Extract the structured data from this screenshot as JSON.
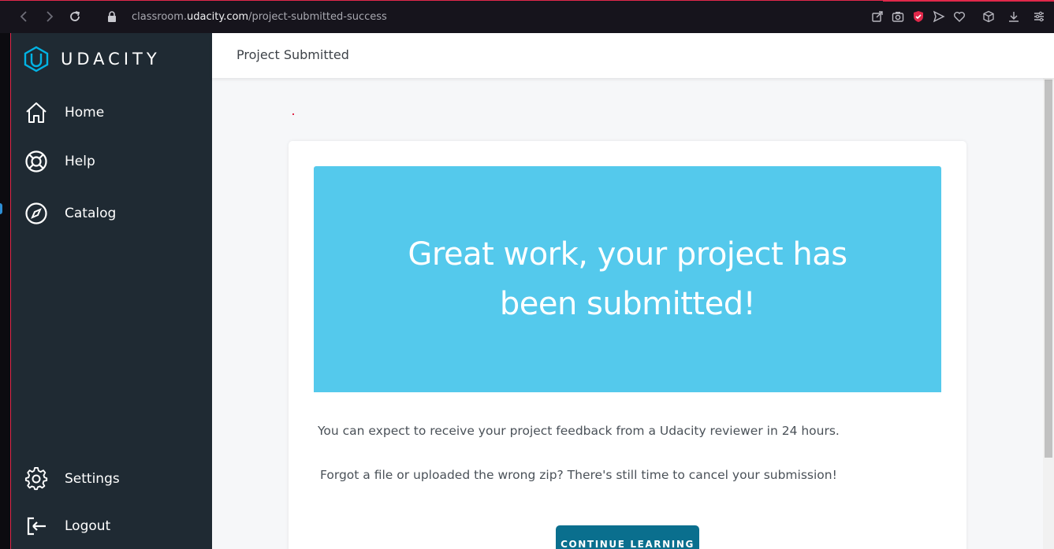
{
  "browser": {
    "url_prefix": "classroom.",
    "url_domain": "udacity.com",
    "url_path": "/project-submitted-success",
    "icons": [
      "back-icon",
      "forward-icon",
      "reload-icon",
      "lock-icon",
      "share-icon",
      "camera-icon",
      "shield-icon",
      "send-icon",
      "heart-icon",
      "cube-icon",
      "download-icon",
      "menu-icon"
    ]
  },
  "sidebar": {
    "logo_text": "UDACITY",
    "items": [
      {
        "label": "Home",
        "icon": "home-icon"
      },
      {
        "label": "Help",
        "icon": "lifebuoy-icon"
      },
      {
        "label": "Catalog",
        "icon": "compass-icon"
      },
      {
        "label": "Settings",
        "icon": "gear-icon"
      },
      {
        "label": "Logout",
        "icon": "logout-icon"
      }
    ]
  },
  "header": {
    "title": "Project Submitted"
  },
  "card": {
    "banner_text": "Great work, your project has been submitted!",
    "message_1": "You can expect to receive your project feedback from a Udacity reviewer in 24 hours.",
    "message_2": "Forgot a file or uploaded the wrong zip? There's still time to cancel your submission!",
    "button_label": "CONTINUE LEARNING"
  },
  "colors": {
    "sidebar_bg": "#1f2a33",
    "banner_bg": "#54c9ec",
    "button_bg": "#0a6f8e",
    "accent": "#02b3e4"
  }
}
